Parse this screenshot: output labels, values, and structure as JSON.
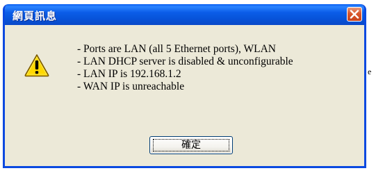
{
  "dialog": {
    "title": "網頁訊息",
    "message_lines": [
      "- Ports are LAN (all 5 Ethernet ports), WLAN",
      "- LAN DHCP server is disabled & unconfigurable",
      "- LAN IP is 192.168.1.2",
      "- WAN IP is unreachable"
    ],
    "ok_label": "確定",
    "icon": "warning-icon",
    "close_icon": "close-icon"
  },
  "background": {
    "stray_char": "e"
  },
  "colors": {
    "titlebar": "#0a5ff2",
    "dialog_bg": "#ece9d8",
    "close_button": "#d9562b",
    "warning_yellow": "#ffd800"
  }
}
